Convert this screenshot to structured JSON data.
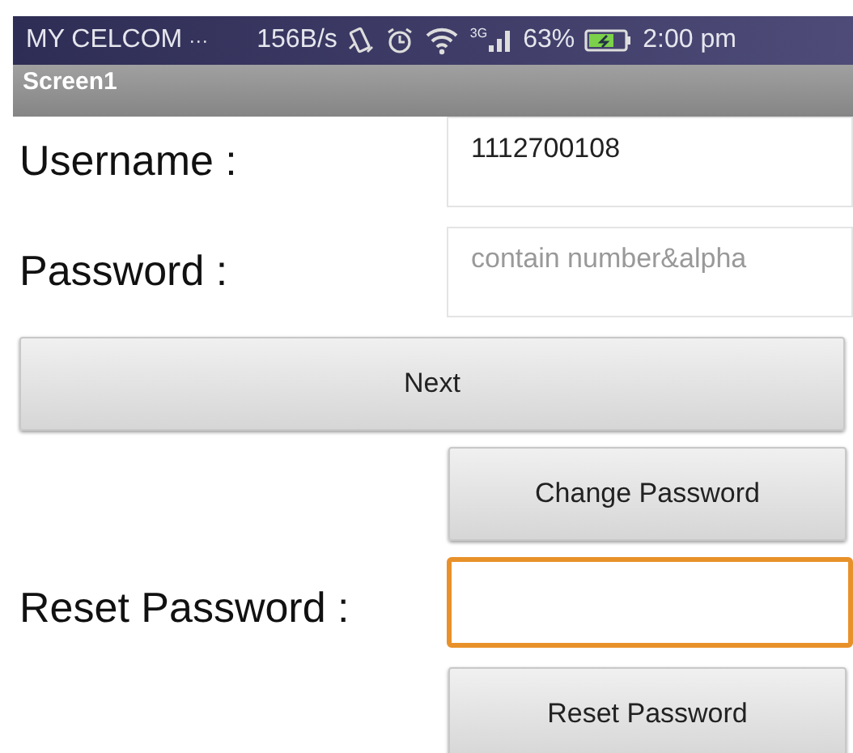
{
  "status_bar": {
    "carrier": "MY CELCOM",
    "more": "···",
    "speed": "156B/s",
    "network": "3G",
    "battery": "63%",
    "charging": true,
    "time": "2:00 pm"
  },
  "title_bar": {
    "title": "Screen1"
  },
  "rows": [
    {
      "kind": "field",
      "label": "Username :",
      "value": "1112700108",
      "focused": false
    },
    {
      "kind": "field",
      "label": "Password :",
      "placeholder": "contain number&alpha",
      "focused": false
    },
    {
      "kind": "wide_button",
      "label": "Next"
    },
    {
      "kind": "right_button",
      "label": "Change Password"
    },
    {
      "kind": "field",
      "label": "Reset Password :",
      "value": "",
      "focused": true
    },
    {
      "kind": "right_button",
      "label": "Reset Password"
    }
  ]
}
